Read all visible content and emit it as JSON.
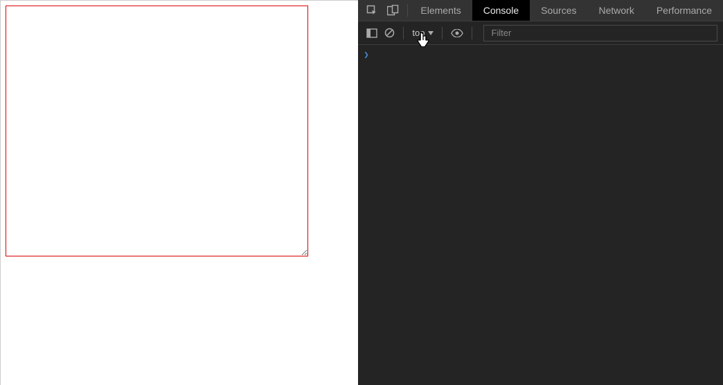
{
  "page": {
    "textarea_value": ""
  },
  "devtools": {
    "tabs": [
      "Elements",
      "Console",
      "Sources",
      "Network",
      "Performance"
    ],
    "active_tab_index": 1,
    "toolbar": {
      "context_label": "top",
      "filter_placeholder": "Filter",
      "filter_value": ""
    },
    "console": {
      "prompt_symbol": "❯"
    }
  },
  "icons": {
    "inspect": "inspect-icon",
    "device": "device-icon",
    "sidebar": "sidebar-toggle-icon",
    "clear": "clear-console-icon",
    "eye": "eye-icon"
  }
}
